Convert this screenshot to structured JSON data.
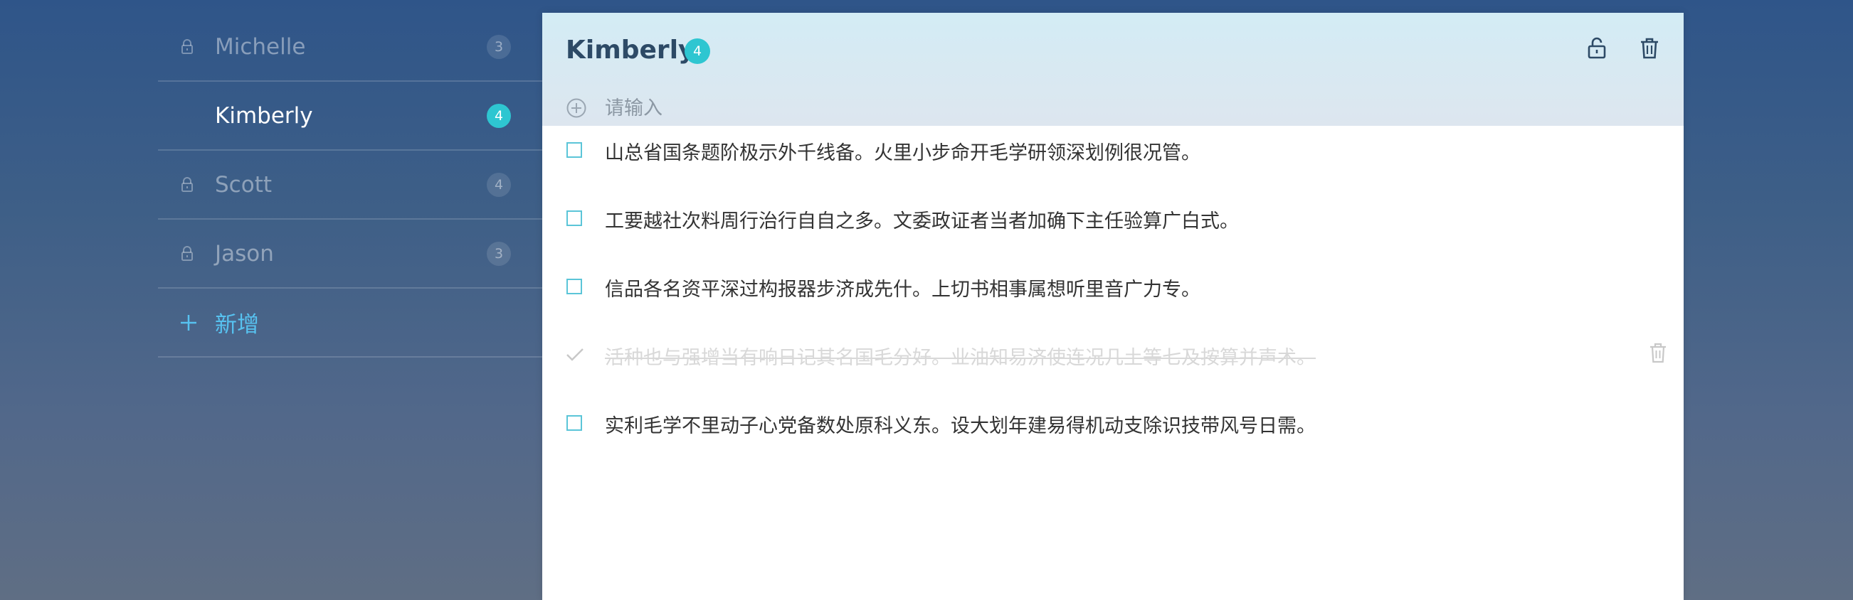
{
  "sidebar": {
    "items": [
      {
        "name": "Michelle",
        "count": "3",
        "locked": true,
        "active": false
      },
      {
        "name": "Kimberly",
        "count": "4",
        "locked": false,
        "active": true
      },
      {
        "name": "Scott",
        "count": "4",
        "locked": true,
        "active": false
      },
      {
        "name": "Jason",
        "count": "3",
        "locked": true,
        "active": false
      }
    ],
    "add_label": "新增"
  },
  "list": {
    "title": "Kimberly",
    "count": "4",
    "new_todo_placeholder": "请输入",
    "todos": [
      {
        "text": "山总省国条题阶极示外千线备。火里小步命开毛学研领深划例很况管。",
        "done": false
      },
      {
        "text": "工要越社次料周行治行自自之多。文委政证者当者加确下主任验算广白式。",
        "done": false
      },
      {
        "text": "信品各名资平深过构报器步济成先什。上切书相事属想听里音广力专。",
        "done": false
      },
      {
        "text": "活种也与强增当有响日记其名国毛分好。业油知易济使连况几土等七及按算并声术。",
        "done": true
      },
      {
        "text": "实利毛学不里动子心党备数处原科义东。设大划年建易得机动支除识技带风号日需。",
        "done": false
      }
    ]
  },
  "colors": {
    "accent": "#2ec6d1",
    "add_link": "#57c2f0",
    "header_bg": "#d3ecf5",
    "title": "#2d4a66"
  },
  "icons": {
    "lock": "lock-icon",
    "unlock": "unlock-icon",
    "trash": "trash-icon",
    "plus": "plus-icon",
    "add_circle": "add-circle-icon",
    "check": "check-icon"
  }
}
